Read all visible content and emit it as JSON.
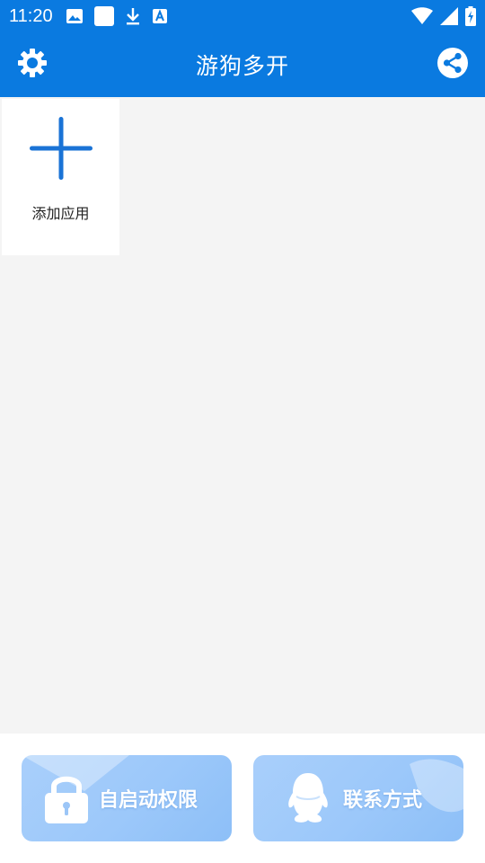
{
  "status_bar": {
    "time": "11:20",
    "icons_left": [
      "image-icon",
      "blank-square-icon",
      "download-icon",
      "text-a-icon"
    ],
    "icons_right": [
      "wifi-icon",
      "signal-icon",
      "battery-charging-icon"
    ]
  },
  "app_bar": {
    "title": "游狗多开",
    "left_icon": "gear-icon",
    "right_icon": "share-icon"
  },
  "apps": {
    "add_label": "添加应用",
    "add_icon": "plus-icon"
  },
  "bottom": {
    "autostart_label": "自启动权限",
    "autostart_icon": "lock-icon",
    "contact_label": "联系方式",
    "contact_icon": "qq-penguin-icon"
  },
  "colors": {
    "primary": "#0a7ae0",
    "accent_plus": "#1a73d6",
    "background": "#f4f4f4",
    "button_gradient_start": "#a9cffb",
    "button_gradient_end": "#8dbff7"
  }
}
